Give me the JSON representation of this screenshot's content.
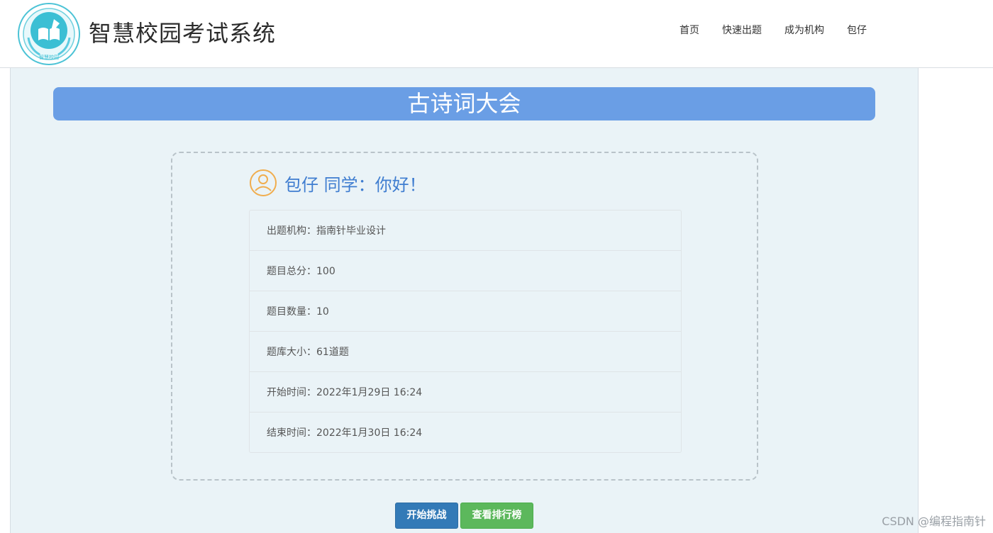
{
  "header": {
    "site_title": "智慧校园考试系统",
    "logo_text": "智慧校园",
    "nav": [
      {
        "label": "首页"
      },
      {
        "label": "快速出题"
      },
      {
        "label": "成为机构"
      },
      {
        "label": "包仔"
      }
    ]
  },
  "main": {
    "banner_title": "古诗词大会",
    "greeting": "包仔 同学：你好！",
    "info": [
      {
        "text": "出题机构：指南针毕业设计"
      },
      {
        "text": "题目总分：100"
      },
      {
        "text": "题目数量：10"
      },
      {
        "text": "题库大小：61道题"
      },
      {
        "text": "开始时间：2022年1月29日 16:24"
      },
      {
        "text": "结束时间：2022年1月30日 16:24"
      }
    ],
    "start_button": "开始挑战",
    "rank_button": "查看排行榜"
  },
  "watermark": "CSDN @编程指南针",
  "colors": {
    "banner": "#6a9ee5",
    "greeting_text": "#3f7dd0",
    "user_icon": "#f0ad4e",
    "start_button": "#337ab7",
    "rank_button": "#5cb85c",
    "content_bg": "#eaf3f7"
  }
}
